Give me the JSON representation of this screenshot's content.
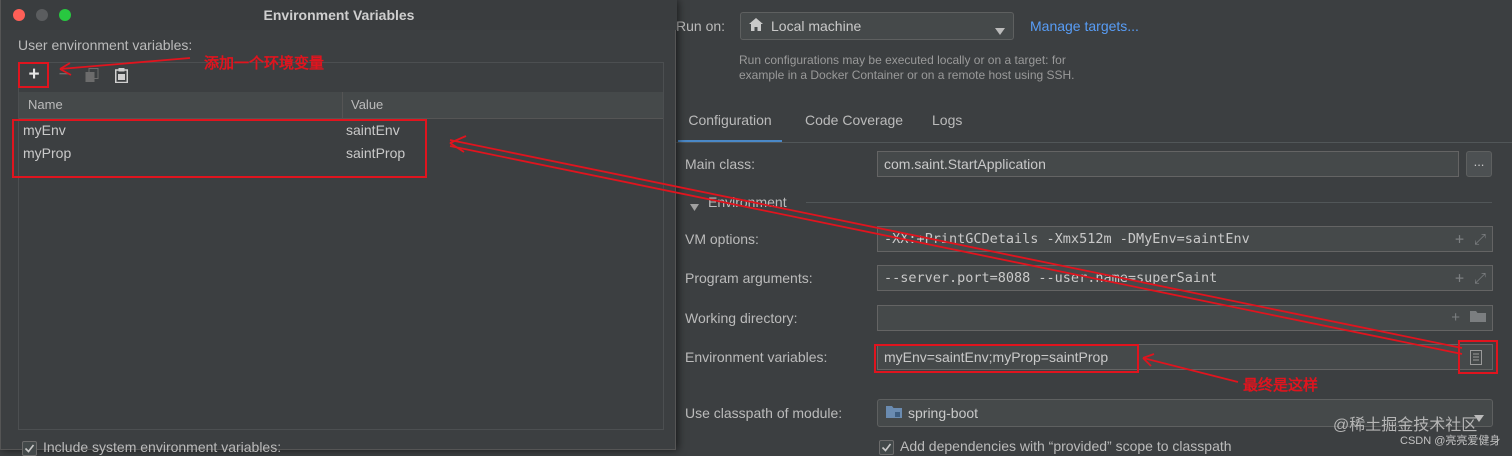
{
  "dialog": {
    "title": "Environment Variables",
    "section_label": "User environment variables:",
    "toolbar": {
      "add": "+",
      "remove": "−"
    },
    "columns": {
      "name": "Name",
      "value": "Value"
    },
    "rows": [
      {
        "name": "myEnv",
        "value": "saintEnv"
      },
      {
        "name": "myProp",
        "value": "saintProp"
      }
    ],
    "include_system_label": "Include system environment variables:"
  },
  "run": {
    "run_on_label": "Run on:",
    "run_on_value": "Local machine",
    "manage_targets": "Manage targets...",
    "hint_line1": "Run configurations may be executed locally or on a target: for",
    "hint_line2": "example in a Docker Container or on a remote host using SSH.",
    "tabs": [
      "Configuration",
      "Code Coverage",
      "Logs"
    ],
    "main_class_label": "Main class:",
    "main_class_value": "com.saint.StartApplication",
    "browse_label": "...",
    "environment_section": "Environment",
    "vm_options_label": "VM options:",
    "vm_options_value": "-XX:+PrintGCDetails -Xmx512m -DMyEnv=saintEnv",
    "program_args_label": "Program arguments:",
    "program_args_value": "--server.port=8088 --user.name=superSaint",
    "working_dir_label": "Working directory:",
    "working_dir_value": "",
    "env_vars_label": "Environment variables:",
    "env_vars_value": "myEnv=saintEnv;myProp=saintProp",
    "classpath_label": "Use classpath of module:",
    "classpath_value": "spring-boot",
    "provided_scope_label": "Add dependencies with “provided” scope to classpath"
  },
  "annotations": {
    "add_note": "添加一个环境变量",
    "final_note": "最终是这样"
  },
  "watermark": {
    "line1": "@稀土掘金技术社区",
    "line2": "CSDN @亮亮爱健身"
  },
  "colors": {
    "background": "#3c3f41",
    "field": "#45494a",
    "accent": "#4a88c7",
    "link": "#589df6",
    "annotation": "#e0141e"
  }
}
